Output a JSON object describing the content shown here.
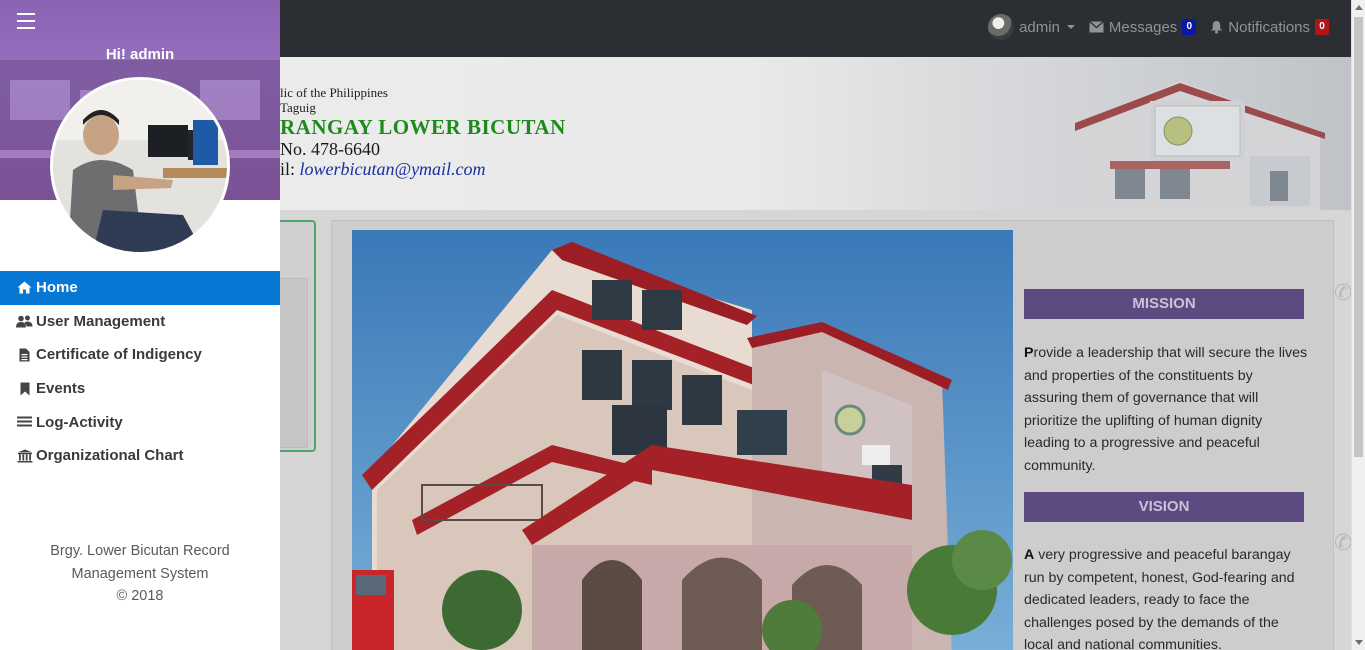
{
  "topbar": {
    "user_label": "admin",
    "messages_label": "Messages",
    "messages_count": "0",
    "notifications_label": "Notifications",
    "notifications_count": "0"
  },
  "banner": {
    "line1": "lic of the Philippines",
    "line2": "Taguig",
    "line3": "RANGAY LOWER BICUTAN",
    "line4": "No. 478-6640",
    "line5_prefix": "il: ",
    "line5_email": "lowerbicutan@ymail.com"
  },
  "sidebar": {
    "greeting": "Hi! admin",
    "items": [
      {
        "label": "Home",
        "icon": "home-icon",
        "active": true
      },
      {
        "label": "User Management",
        "icon": "users-icon"
      },
      {
        "label": "Certificate of Indigency",
        "icon": "file-icon"
      },
      {
        "label": "Events",
        "icon": "bookmark-icon"
      },
      {
        "label": "Log-Activity",
        "icon": "list-icon"
      },
      {
        "label": "Organizational Chart",
        "icon": "institution-icon"
      }
    ],
    "footer_line1": "Brgy. Lower Bicutan Record",
    "footer_line2": "Management System",
    "footer_line3": "© 2018"
  },
  "content": {
    "mission_title": "MISSION",
    "mission_first": "P",
    "mission_text": "rovide a leadership that will secure the lives and properties of the constituents by assuring them of governance that will prioritize the uplifting of human dignity leading to a progressive and peaceful community.",
    "vision_title": "VISION",
    "vision_first": "A",
    "vision_text": " very progressive and peaceful barangay run by competent, honest, God-fearing and dedicated leaders, ready to face the challenges posed by the demands of the local and national communities."
  },
  "colors": {
    "accent": "#0777d4",
    "sidebar_hero": "#8a63b3",
    "section_header": "#5c4a80",
    "topbar": "#2b2f33",
    "banner_title": "#1e8a1e"
  }
}
